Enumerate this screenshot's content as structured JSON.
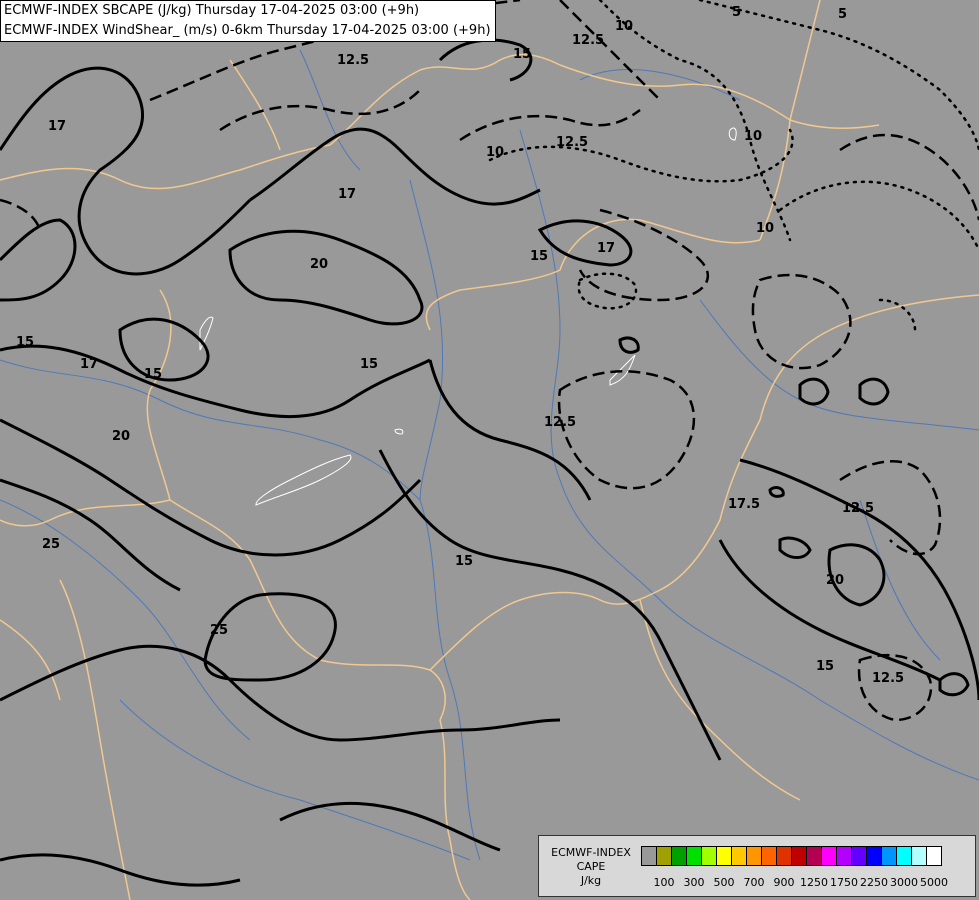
{
  "title": {
    "line1": "ECMWF-INDEX SBCAPE (J/kg) Thursday 17-04-2025 03:00 (+9h)",
    "line2": "ECMWF-INDEX WindShear_ (m/s) 0-6km Thursday 17-04-2025 03:00 (+9h)"
  },
  "contour_labels": [
    "5",
    "5",
    "10",
    "10",
    "10",
    "10",
    "12.5",
    "12.5",
    "12.5",
    "12.5",
    "12.5",
    "15",
    "15",
    "15",
    "15",
    "15",
    "15",
    "17",
    "17",
    "17",
    "17",
    "17.5",
    "20",
    "20",
    "20",
    "25",
    "25"
  ],
  "legend": {
    "caption_line1": "ECMWF-INDEX",
    "caption_line2": "CAPE",
    "caption_line3": "J/kg",
    "ticks": [
      "100",
      "300",
      "500",
      "700",
      "900",
      "1250",
      "1750",
      "2250",
      "3000",
      "5000"
    ],
    "colors": [
      "#999999",
      "#a0a000",
      "#00a000",
      "#00e000",
      "#a0ff00",
      "#ffff00",
      "#ffc800",
      "#ff9600",
      "#ff6400",
      "#e03200",
      "#c00000",
      "#b40050",
      "#ff00ff",
      "#b400ff",
      "#6400ff",
      "#0000ff",
      "#0096ff",
      "#00ffff",
      "#b4ffff",
      "#ffffff"
    ]
  },
  "colors": {
    "background": "#999999",
    "borders": "#f0c890",
    "rivers": "#5080c0",
    "contours": "#000000"
  }
}
